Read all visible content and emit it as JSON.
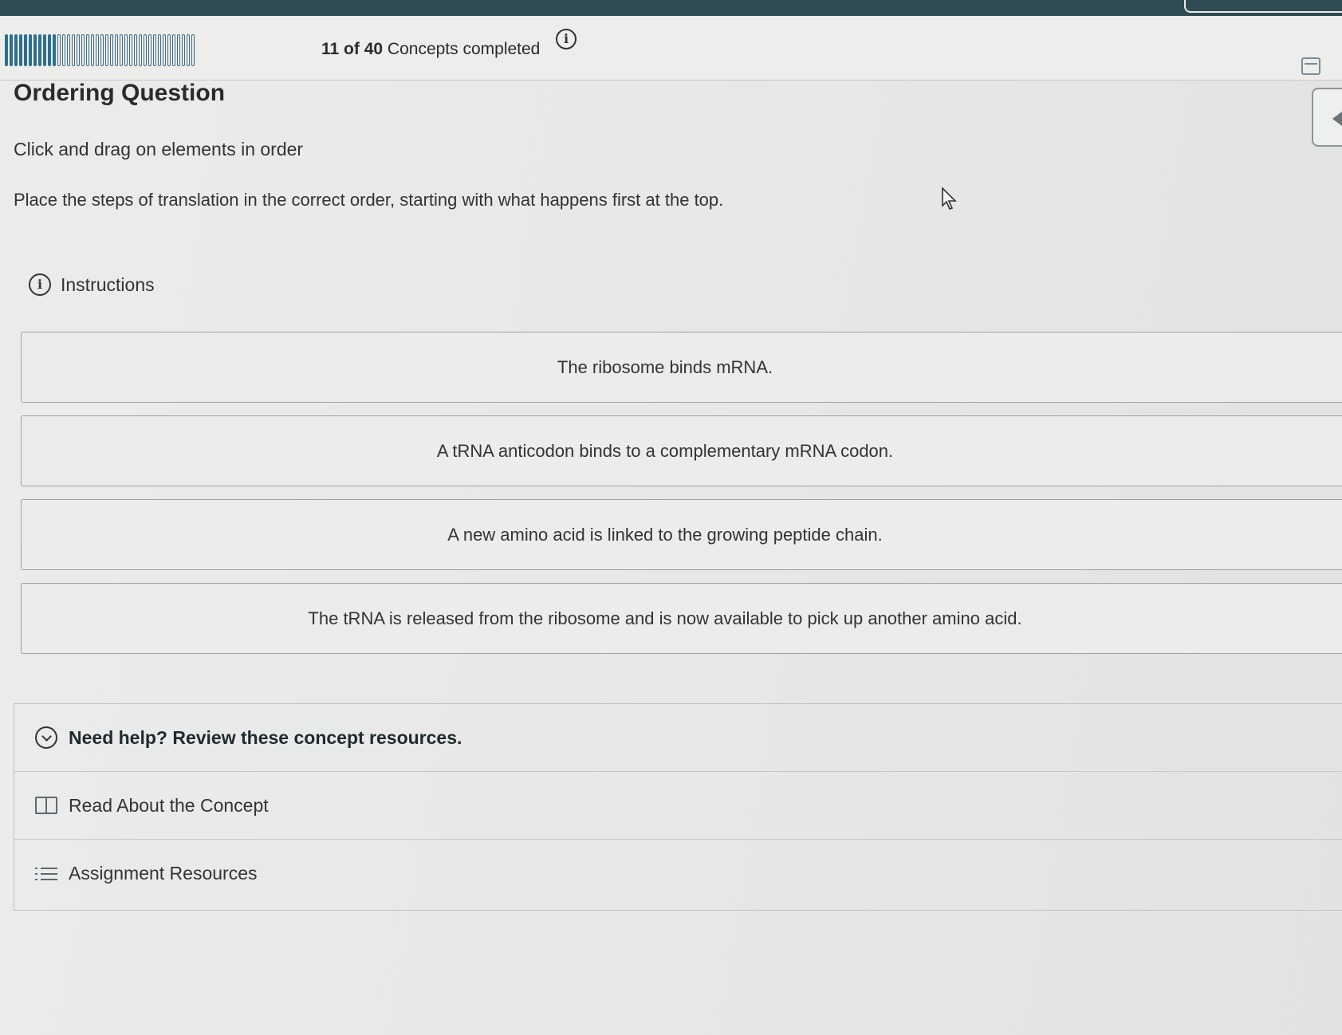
{
  "header": {
    "progress_completed_count": "11",
    "progress_of_label": "of",
    "progress_total": "40",
    "progress_suffix": "Concepts completed",
    "completed_ticks": 11,
    "total_ticks": 40,
    "progress_color": "#2c6f8f"
  },
  "question": {
    "type_label": "Ordering Question",
    "instruction": "Click and drag on elements in order",
    "prompt": "Place the steps of translation in the correct order, starting with what happens first at the top.",
    "instructions_label": "Instructions"
  },
  "order_items": [
    "The ribosome binds mRNA.",
    "A tRNA anticodon binds to a complementary mRNA codon.",
    "A new amino acid is linked to the growing peptide chain.",
    "The tRNA is released from the ribosome and is now available to pick up another amino acid."
  ],
  "help": {
    "heading": "Need help? Review these concept resources.",
    "read_about": "Read About the Concept",
    "assignment_resources": "Assignment Resources"
  },
  "icons": {
    "progress_info": "info-icon",
    "calendar": "calendar-icon",
    "instructions": "info-icon",
    "expand": "chevron-down-icon",
    "book": "book-icon",
    "list": "list-icon",
    "speaker": "speaker-icon"
  }
}
